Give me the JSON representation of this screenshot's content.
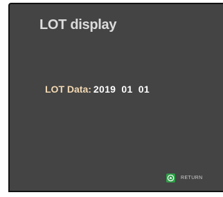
{
  "screen": {
    "title": "LOT display",
    "lot": {
      "label": "LOT Data:",
      "value": "2019 01 01"
    },
    "return_button": {
      "icon": "return-icon",
      "label": "RETURN",
      "icon_color": "#2e9e47"
    }
  }
}
